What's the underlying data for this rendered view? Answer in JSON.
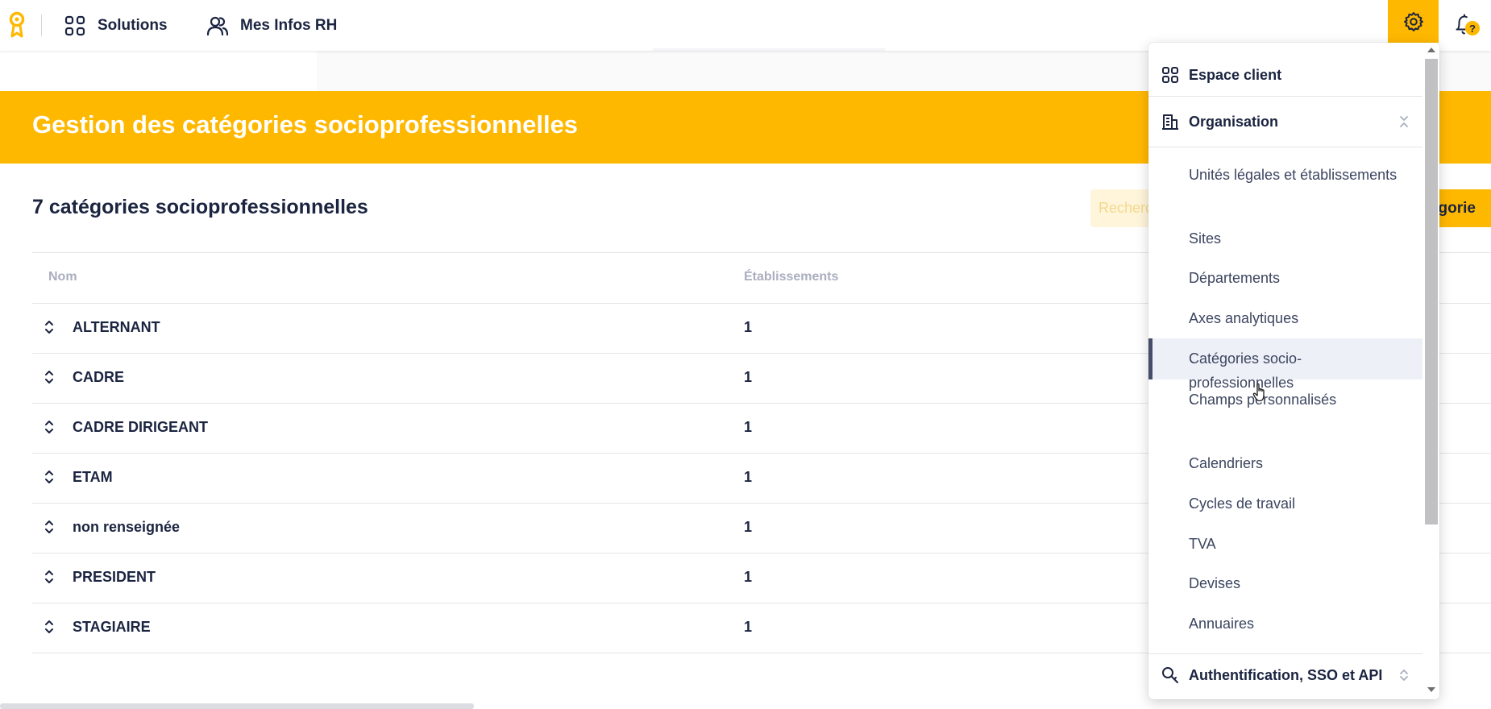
{
  "topbar": {
    "solutions_label": "Solutions",
    "infos_label": "Mes Infos RH",
    "notification_badge": "?"
  },
  "banner": {
    "title": "Gestion des catégories socioprofessionnelles"
  },
  "content": {
    "count_title": "7 catégories socioprofessionnelles",
    "search_placeholder": "Recherche",
    "add_button_label": "Ajouter une catégorie",
    "add_button_visible": "gorie",
    "columns": {
      "nom": "Nom",
      "etablissements": "Établissements"
    },
    "rows": [
      {
        "nom": "ALTERNANT",
        "etablissements": "1"
      },
      {
        "nom": "CADRE",
        "etablissements": "1"
      },
      {
        "nom": "CADRE DIRIGEANT",
        "etablissements": "1"
      },
      {
        "nom": "ETAM",
        "etablissements": "1"
      },
      {
        "nom": "non renseignée",
        "etablissements": "1"
      },
      {
        "nom": "PRESIDENT",
        "etablissements": "1"
      },
      {
        "nom": "STAGIAIRE",
        "etablissements": "1"
      }
    ]
  },
  "menu": {
    "espace_client": "Espace client",
    "organisation": "Organisation",
    "items": [
      "Unités légales et établissements",
      "Sites",
      "Départements",
      "Axes analytiques",
      "Catégories socio-professionnelles",
      "Champs personnalisés",
      "Calendriers",
      "Cycles de travail",
      "TVA",
      "Devises",
      "Annuaires"
    ],
    "active_item": "Catégories socio-professionnelles",
    "auth": "Authentification, SSO et API"
  },
  "colors": {
    "accent": "#ffb800",
    "text": "#1b2440",
    "active_bg": "#eef0f7",
    "muted_header": "#a9aebf"
  },
  "icons": {
    "logo": "figgo-logo-icon",
    "solutions": "grid-icon",
    "infos": "users-icon",
    "settings": "gear-icon",
    "notifications": "bell-icon",
    "sort": "sort-icon",
    "espace_client": "grid-icon",
    "organisation": "building-icon",
    "auth": "search-key-icon"
  }
}
